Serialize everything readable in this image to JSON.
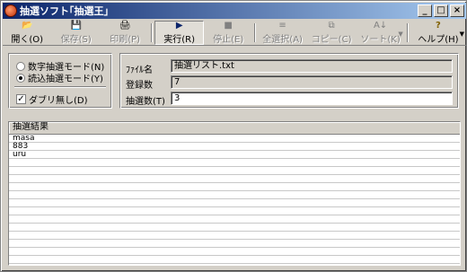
{
  "window": {
    "title": "抽選ソフト｢抽選王｣",
    "controls": {
      "minimize": "_",
      "maximize": "□",
      "close": "×"
    }
  },
  "toolbar": {
    "items": [
      {
        "label": "開く(O)",
        "icon": "folder-open-icon",
        "glyph": "📂",
        "enabled": true
      },
      {
        "label": "保存(S)",
        "icon": "save-icon",
        "glyph": "💾",
        "enabled": false
      },
      {
        "label": "印刷(P)",
        "icon": "print-icon",
        "glyph": "🖨",
        "enabled": false
      },
      {
        "label": "実行(R)",
        "icon": "play-icon",
        "glyph": "▶",
        "enabled": true,
        "active": true
      },
      {
        "label": "停止(E)",
        "icon": "stop-icon",
        "glyph": "■",
        "enabled": false
      },
      {
        "label": "全選択(A)",
        "icon": "select-all-icon",
        "glyph": "≡",
        "enabled": false
      },
      {
        "label": "コピー(C)",
        "icon": "copy-icon",
        "glyph": "⧉",
        "enabled": false
      },
      {
        "label": "ソート(K)",
        "icon": "sort-az-icon",
        "glyph": "A↓",
        "enabled": false
      },
      {
        "label": "ヘルプ(H)",
        "icon": "help-icon",
        "glyph": "?",
        "enabled": true
      }
    ]
  },
  "mode": {
    "numeric_label": "数字抽選モード(N)",
    "read_label": "読込抽選モード(Y)",
    "selected": "read",
    "no_duplicates_label": "ダブリ無し(D)",
    "no_duplicates_checked": true,
    "check_mark": "✓"
  },
  "info": {
    "filename_label": "ﾌｧｲﾙ名",
    "filename_value": "抽選リスト.txt",
    "count_label": "登録数",
    "count_value": "7",
    "draw_label": "抽選数(T)",
    "draw_value": "3"
  },
  "results": {
    "header": "抽選結果",
    "items": [
      "masa",
      "883",
      "uru"
    ]
  },
  "colors": {
    "titlebar_start": "#0a246a",
    "titlebar_end": "#a6caf0",
    "face": "#d4d0c8"
  }
}
